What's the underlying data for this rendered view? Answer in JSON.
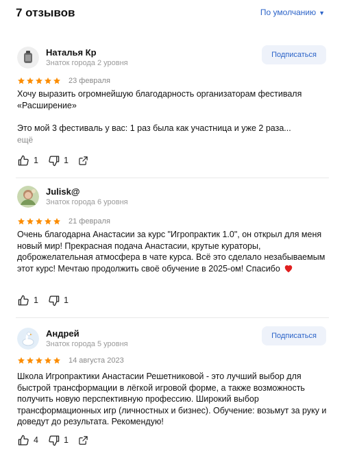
{
  "header": {
    "title": "7 отзывов",
    "sort_label": "По умолчанию"
  },
  "reviews": [
    {
      "author": "Наталья Кр",
      "level": "Знаток города 2 уровня",
      "subscribe_label": "Подписаться",
      "rating": 5,
      "date": "23 февраля",
      "text": "Хочу выразить огромнейшую благодарность организаторам фестиваля «Расширение»\n\nЭто мой 3 фестиваль у вас: 1 раз была как участница и уже 2 раза...",
      "more_label": "ещё",
      "likes": "1",
      "dislikes": "1"
    },
    {
      "author": "Julisk@",
      "level": "Знаток города 6 уровня",
      "rating": 5,
      "date": "21 февраля",
      "text": "Очень благодарна Анастасии за курс \"Игропрактик 1.0\", он открыл для меня новый мир! Прекрасная подача Анастасии, крутые кураторы, доброжелательная атмосфера в чате курса. Всё это сделало незабываемым этот курс! Мечтаю продолжить своё обучение в 2025-ом! Спасибо",
      "likes": "1",
      "dislikes": "1"
    },
    {
      "author": "Андрей",
      "level": "Знаток города 5 уровня",
      "subscribe_label": "Подписаться",
      "rating": 5,
      "date": "14 августа 2023",
      "text": "Школа Игропрактики Анастасии Решетниковой - это лучший выбор для быстрой трансформации в лёгкой игровой форме, а также возможность получить новую перспективную профессию. Широкий выбор трансформационных игр (личностных и бизнес). Обучение: возьмут за руку и доведут до результата. Рекомендую!",
      "likes": "4",
      "dislikes": "1"
    }
  ],
  "colors": {
    "star": "#fc8c00",
    "accent": "#2b63c8",
    "heart": "#e02020"
  },
  "icons": [
    "thumb-up-icon",
    "thumb-down-icon",
    "share-icon",
    "heart-icon",
    "chevron-down-icon",
    "star-icon"
  ]
}
